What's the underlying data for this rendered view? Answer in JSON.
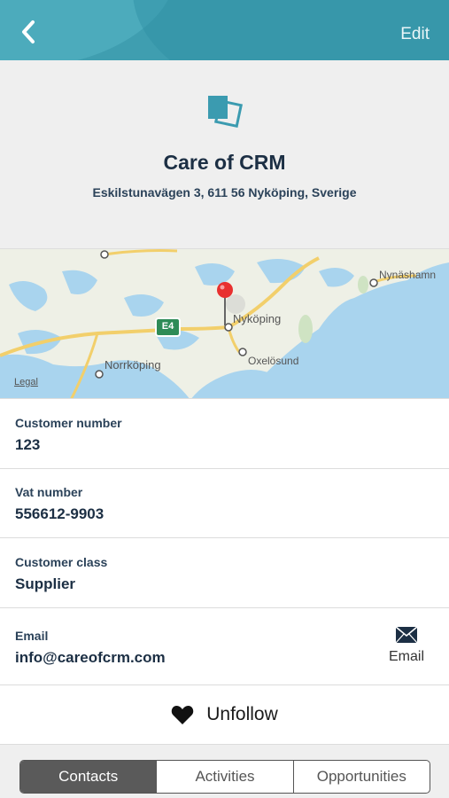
{
  "nav": {
    "back_icon": "chevron-left-icon",
    "edit_label": "Edit"
  },
  "company": {
    "name": "Care of CRM",
    "address": "Eskilstunavägen 3, 611 56 Nyköping, Sverige"
  },
  "map": {
    "labels": {
      "nykoping": "Nyköping",
      "norrkoping": "Norrköping",
      "oxelosund": "Oxelösund",
      "nynashamn": "Nynäshamn",
      "road": "E4",
      "legal": "Legal"
    }
  },
  "fields": [
    {
      "label": "Customer number",
      "value": "123"
    },
    {
      "label": "Vat number",
      "value": "556612-9903"
    },
    {
      "label": "Customer class",
      "value": "Supplier"
    },
    {
      "label": "Email",
      "value": "info@careofcrm.com"
    }
  ],
  "email_action": {
    "label": "Email"
  },
  "follow": {
    "label": "Unfollow"
  },
  "tabs": [
    {
      "label": "Contacts",
      "active": true
    },
    {
      "label": "Activities",
      "active": false
    },
    {
      "label": "Opportunities",
      "active": false
    }
  ]
}
